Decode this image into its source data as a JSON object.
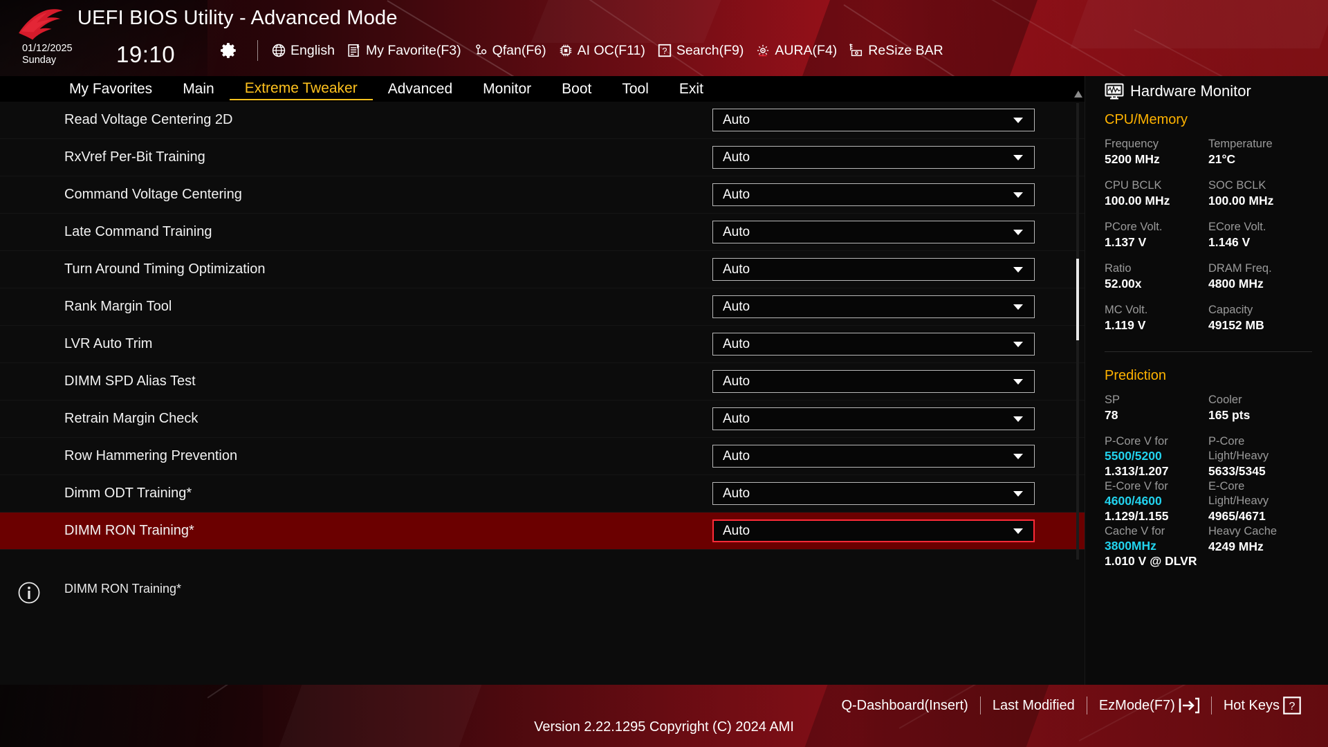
{
  "header": {
    "title": "UEFI BIOS Utility - Advanced Mode",
    "date": "01/12/2025",
    "weekday": "Sunday",
    "time": "19:10",
    "gear_icon": "gear-icon",
    "tools": [
      {
        "icon": "globe-icon",
        "label": "English"
      },
      {
        "icon": "favorite-icon",
        "label": "My Favorite(F3)"
      },
      {
        "icon": "qfan-icon",
        "label": "Qfan(F6)"
      },
      {
        "icon": "aioc-icon",
        "label": "AI OC(F11)"
      },
      {
        "icon": "question-icon",
        "label": "Search(F9)"
      },
      {
        "icon": "aura-icon",
        "label": "AURA(F4)"
      },
      {
        "icon": "resizebar-icon",
        "label": "ReSize BAR"
      }
    ]
  },
  "nav": {
    "tabs": [
      {
        "label": "My Favorites",
        "active": false
      },
      {
        "label": "Main",
        "active": false
      },
      {
        "label": "Extreme Tweaker",
        "active": true
      },
      {
        "label": "Advanced",
        "active": false
      },
      {
        "label": "Monitor",
        "active": false
      },
      {
        "label": "Boot",
        "active": false
      },
      {
        "label": "Tool",
        "active": false
      },
      {
        "label": "Exit",
        "active": false
      }
    ]
  },
  "settings": {
    "rows": [
      {
        "label": "Read Voltage Centering 2D",
        "value": "Auto",
        "selected": false
      },
      {
        "label": "RxVref Per-Bit Training",
        "value": "Auto",
        "selected": false
      },
      {
        "label": "Command Voltage Centering",
        "value": "Auto",
        "selected": false
      },
      {
        "label": "Late Command Training",
        "value": "Auto",
        "selected": false
      },
      {
        "label": "Turn Around Timing Optimization",
        "value": "Auto",
        "selected": false
      },
      {
        "label": "Rank Margin Tool",
        "value": "Auto",
        "selected": false
      },
      {
        "label": "LVR Auto Trim",
        "value": "Auto",
        "selected": false
      },
      {
        "label": "DIMM SPD Alias Test",
        "value": "Auto",
        "selected": false
      },
      {
        "label": "Retrain Margin Check",
        "value": "Auto",
        "selected": false
      },
      {
        "label": "Row Hammering Prevention",
        "value": "Auto",
        "selected": false
      },
      {
        "label": "Dimm ODT Training*",
        "value": "Auto",
        "selected": false
      },
      {
        "label": "DIMM RON Training*",
        "value": "Auto",
        "selected": true
      }
    ]
  },
  "info": {
    "icon": "info-icon",
    "text": "DIMM RON Training*"
  },
  "hardware_monitor": {
    "icon": "monitor-icon",
    "title": "Hardware Monitor",
    "sections": [
      {
        "name": "CPU/Memory",
        "pairs": [
          {
            "left_key": "Frequency",
            "left_val": "5200 MHz",
            "right_key": "Temperature",
            "right_val": "21°C"
          },
          {
            "left_key": "CPU BCLK",
            "left_val": "100.00 MHz",
            "right_key": "SOC BCLK",
            "right_val": "100.00 MHz"
          },
          {
            "left_key": "PCore Volt.",
            "left_val": "1.137 V",
            "right_key": "ECore Volt.",
            "right_val": "1.146 V"
          },
          {
            "left_key": "Ratio",
            "left_val": "52.00x",
            "right_key": "DRAM Freq.",
            "right_val": "4800 MHz"
          },
          {
            "left_key": "MC Volt.",
            "left_val": "1.119 V",
            "right_key": "Capacity",
            "right_val": "49152 MB"
          }
        ]
      },
      {
        "name": "Prediction",
        "pairs": [
          {
            "left_key": "SP",
            "left_val": "78",
            "right_key": "Cooler",
            "right_val": "165 pts"
          }
        ],
        "blocks": [
          {
            "left_k1": "P-Core V for",
            "left_k2": "5500/5200",
            "left_val": "1.313/1.207",
            "right_k1": "P-Core",
            "right_k2": "Light/Heavy",
            "right_val": "5633/5345"
          },
          {
            "left_k1": "E-Core V for",
            "left_k2": "4600/4600",
            "left_val": "1.129/1.155",
            "right_k1": "E-Core",
            "right_k2": "Light/Heavy",
            "right_val": "4965/4671"
          },
          {
            "left_k1": "Cache V for",
            "left_k2": "3800MHz",
            "left_val": "1.010 V @ DLVR",
            "right_k1": "Heavy Cache",
            "right_k2": "",
            "right_val": "4249 MHz"
          }
        ]
      }
    ]
  },
  "footer": {
    "links": [
      {
        "label": "Q-Dashboard(Insert)",
        "icon": ""
      },
      {
        "label": "Last Modified",
        "icon": ""
      },
      {
        "label": "EzMode(F7)",
        "icon": "exit-arrow-icon"
      },
      {
        "label": "Hot Keys",
        "icon": "question-box-icon"
      }
    ],
    "version": "Version 2.22.1295 Copyright (C) 2024 AMI"
  },
  "colors": {
    "accent_yellow": "#ffc21e",
    "accent_orange": "#ffb300",
    "accent_cyan": "#22d3ee",
    "selected_red": "#6b0000",
    "border_red": "#ff2b38"
  }
}
